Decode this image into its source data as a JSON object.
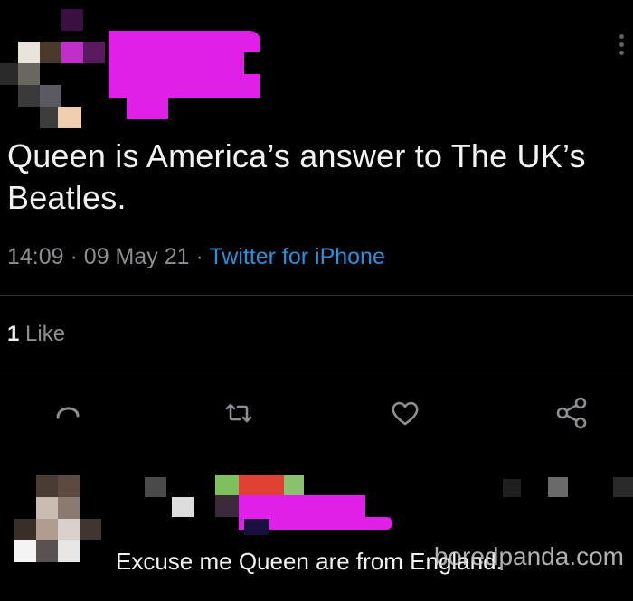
{
  "tweet": {
    "text": "Queen is America’s answer to The UK’s Beatles.",
    "time": "14:09",
    "date": "09 May 21",
    "source": "Twitter for iPhone",
    "separator": "·"
  },
  "engagement": {
    "like_count": "1",
    "like_label": "Like"
  },
  "actions": [
    {
      "icon": "reply-icon"
    },
    {
      "icon": "retweet-icon"
    },
    {
      "icon": "like-heart-icon"
    },
    {
      "icon": "share-icon"
    }
  ],
  "reply": {
    "text": "Excuse me Queen are from England."
  },
  "watermark": "boredpanda.com",
  "colors": {
    "background": "#000000",
    "text": "#f2f2f2",
    "muted": "#8b8f93",
    "link": "#2f8fd9",
    "redaction": "#e020e8"
  }
}
